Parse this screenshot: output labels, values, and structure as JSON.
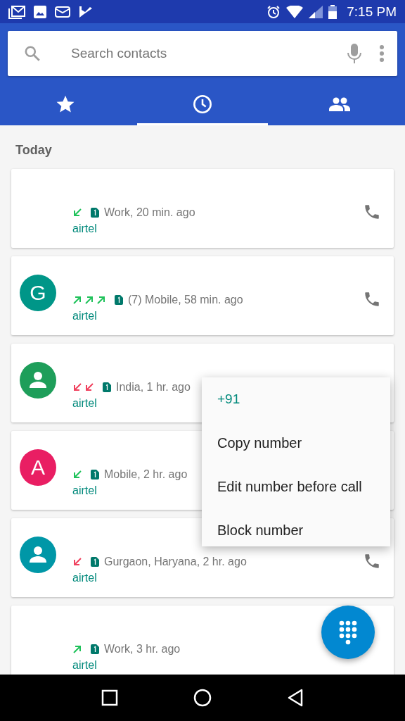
{
  "status_bar": {
    "time": "7:15 PM"
  },
  "search": {
    "placeholder": "Search contacts"
  },
  "tabs": [
    {
      "kind": "favorites",
      "selected": false
    },
    {
      "kind": "recents",
      "selected": true
    },
    {
      "kind": "contacts",
      "selected": false
    }
  ],
  "section_header": "Today",
  "calls": [
    {
      "avatar": {
        "kind": "none"
      },
      "arrows": [
        {
          "kind": "incoming"
        }
      ],
      "details": "Work, 20 min. ago",
      "carrier": "airtel",
      "call_icon": true
    },
    {
      "avatar": {
        "kind": "letter",
        "letter": "G",
        "color": "#009688"
      },
      "arrows": [
        {
          "kind": "outgoing"
        },
        {
          "kind": "outgoing"
        },
        {
          "kind": "outgoing"
        }
      ],
      "details": "(7) Mobile, 58 min. ago",
      "carrier": "airtel",
      "call_icon": true
    },
    {
      "avatar": {
        "kind": "person",
        "color": "#1e9e5a"
      },
      "arrows": [
        {
          "kind": "missed"
        },
        {
          "kind": "missed"
        }
      ],
      "details": "India, 1 hr. ago",
      "carrier": "airtel",
      "call_icon": false
    },
    {
      "avatar": {
        "kind": "letter",
        "letter": "A",
        "color": "#e91e63"
      },
      "arrows": [
        {
          "kind": "incoming"
        }
      ],
      "details": "Mobile, 2 hr. ago",
      "carrier": "airtel",
      "call_icon": false
    },
    {
      "avatar": {
        "kind": "person",
        "color": "#0097a7"
      },
      "arrows": [
        {
          "kind": "missed"
        }
      ],
      "details": "Gurgaon, Haryana, 2 hr. ago",
      "carrier": "airtel",
      "call_icon": true
    },
    {
      "avatar": {
        "kind": "none"
      },
      "arrows": [
        {
          "kind": "outgoing"
        }
      ],
      "details": "Work, 3 hr. ago",
      "carrier": "airtel",
      "call_icon": false
    }
  ],
  "context_menu": {
    "number": "+91",
    "items": [
      "Copy number",
      "Edit number before call",
      "Block number"
    ]
  }
}
